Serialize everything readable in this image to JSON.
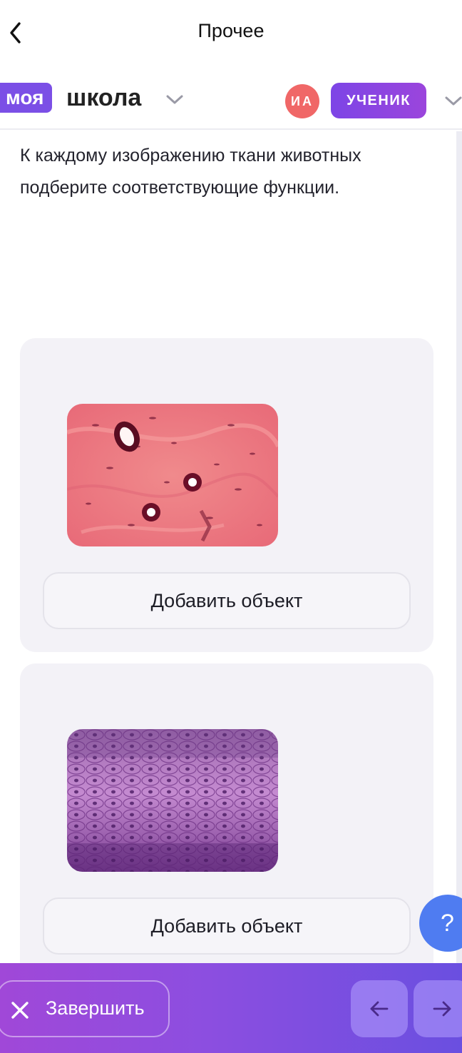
{
  "topbar": {
    "title": "Прочее"
  },
  "header": {
    "logo_badge": "моя",
    "logo_word": "школа",
    "avatar_initials": "ИА",
    "role": "УЧЕНИК"
  },
  "question": {
    "text": "К каждому изображению ткани животных подберите соответствующие функции."
  },
  "cards": [
    {
      "add_label": "Добавить объект"
    },
    {
      "add_label": "Добавить объект"
    }
  ],
  "help": {
    "label": "?"
  },
  "bottombar": {
    "finish_label": "Завершить"
  },
  "colors": {
    "accent": "#7b4fe6",
    "avatar": "#f06767",
    "help": "#4f7cf1",
    "card_bg": "#f3f2f7"
  },
  "icons": {
    "back": "chevron-left-icon",
    "dropdown": "chevron-down-icon",
    "close": "close-icon",
    "prev": "arrow-left-icon",
    "next": "arrow-right-icon"
  }
}
